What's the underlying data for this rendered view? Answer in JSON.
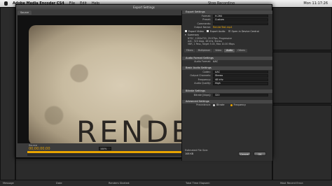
{
  "menubar": {
    "app": "Adobe Media Encoder CS4",
    "items": [
      "File",
      "Edit",
      "Help"
    ],
    "status": "Stop Recording",
    "clock": "Mon 11:17:26"
  },
  "dialog": {
    "title": "Export Settings",
    "source_tab": "Source",
    "source_label": "Source",
    "timecode": "00;00;00;00",
    "zoom": "100%",
    "preview_text": "RENDERTA",
    "timeline_progress": 0.98
  },
  "export_settings": {
    "header": "Export Settings",
    "format_label": "Format:",
    "format_value": "H.264",
    "preset_label": "Preset:",
    "preset_value": "Custom",
    "comments_label": "Comments:",
    "output_label": "Output Name:",
    "output_value": "RenderTest.mp4",
    "export_video": "Export Video",
    "export_audio": "Export Audio",
    "open_device": "Open in Device Central",
    "summary_header": "Summary",
    "summary_lines": [
      "NTSC, 1280x720, 29.97fps, Progressive",
      "AAC, 320 kbps, 48 kHz, Stereo",
      "VBR, 1 Pass, Target 5.00, Max 10.00 Mbps"
    ],
    "tabs": [
      "Filters",
      "Multiplexer",
      "Video",
      "Audio",
      "Others"
    ],
    "active_tab": "Audio"
  },
  "audio": {
    "format_section": "Audio Format Settings",
    "audio_format_label": "Audio Format:",
    "audio_format_value": "AAC",
    "basic_section": "Basic Audio Settings",
    "codec_label": "Codec:",
    "codec_value": "AAC",
    "channels_label": "Output Channels:",
    "channels_value": "Stereo",
    "frequency_label": "Frequency:",
    "frequency_value": "48 kHz",
    "quality_label": "Audio Quality:",
    "quality_value": "High",
    "bitrate_section": "Bitrate Settings",
    "bitrate_label": "Bitrate [kbps]:",
    "bitrate_value": "320",
    "advanced_section": "Advanced Settings",
    "precedence_label": "Precedence:",
    "precedence_bitrate": "Bitrate",
    "precedence_frequency": "Frequency"
  },
  "footer": {
    "estimated_label": "Estimated File Size:",
    "estimated_value": "108 KB",
    "ok": "OK",
    "cancel": "Cancel"
  },
  "statusbar": {
    "message": "Message",
    "dates": "Date",
    "render_started": "Renders Started:",
    "time_elapsed": "Total Time Elapsed:",
    "most_recent_error": "Most Recent Error:"
  },
  "colors": {
    "accent": "#e8a400",
    "dialog_bg": "#3b3b3b",
    "panel_bg": "#2f2f2f"
  }
}
